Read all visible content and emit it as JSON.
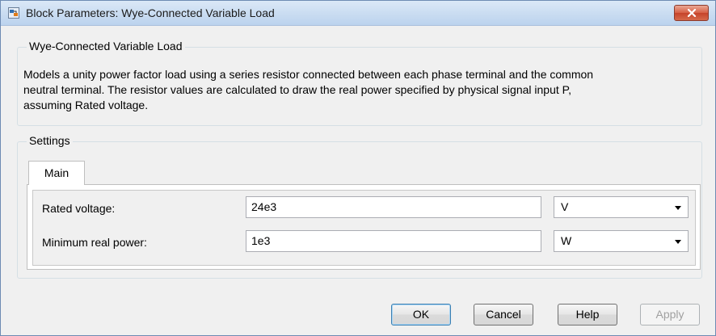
{
  "window": {
    "title": "Block Parameters: Wye-Connected Variable Load",
    "app_icon": "simulink-block-icon",
    "close_icon": "close-icon"
  },
  "block": {
    "group_title": "Wye-Connected Variable Load",
    "description": [
      "Models a unity power factor load using a series resistor connected between each phase terminal and the common",
      "neutral terminal. The resistor values are calculated to draw the real power specified by physical signal input P,",
      "assuming Rated voltage."
    ]
  },
  "settings": {
    "group_title": "Settings",
    "tabs": [
      {
        "label": "Main",
        "selected": true
      }
    ],
    "parameters": [
      {
        "label": "Rated voltage:",
        "value": "24e3",
        "unit": "V"
      },
      {
        "label": "Minimum real power:",
        "value": "1e3",
        "unit": "W"
      }
    ]
  },
  "buttons": {
    "ok": "OK",
    "cancel": "Cancel",
    "help": "Help",
    "apply": "Apply"
  },
  "colors": {
    "title_bar": "#c9dcf1",
    "close_button": "#c5432a",
    "default_button_border": "#3c7fb1"
  }
}
